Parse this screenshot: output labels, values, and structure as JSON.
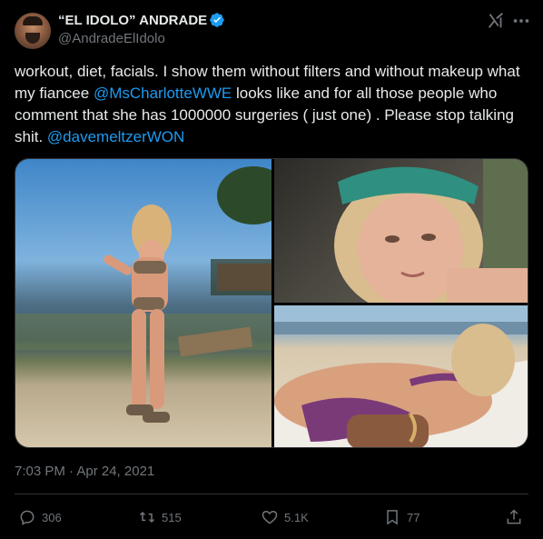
{
  "author": {
    "display_name": "“EL IDOLO” ANDRADE",
    "handle": "@AndradeElIdolo",
    "verified": true
  },
  "tweet": {
    "text_parts": [
      {
        "text": "workout, diet, facials.  I show them without filters and without makeup what my fiancee ",
        "type": "text"
      },
      {
        "text": "@MsCharlotteWWE",
        "type": "mention"
      },
      {
        "text": " looks like and for all those people who comment that she has 1000000 surgeries ( just one) . Please stop talking shit. ",
        "type": "text"
      },
      {
        "text": "@davemeltzerWON",
        "type": "mention"
      }
    ]
  },
  "timestamp": "7:03 PM · Apr 24, 2021",
  "actions": {
    "replies": "306",
    "retweets": "515",
    "likes": "5.1K",
    "bookmarks": "77"
  },
  "icons": {
    "verified": "verified-badge-icon",
    "grok": "grok-icon",
    "more": "more-icon",
    "reply": "reply-icon",
    "retweet": "retweet-icon",
    "like": "heart-icon",
    "bookmark": "bookmark-icon",
    "share": "share-icon"
  },
  "colors": {
    "background": "#000000",
    "text": "#e7e9ea",
    "muted": "#71767b",
    "link": "#1d9bf0",
    "border": "#2f3336"
  }
}
